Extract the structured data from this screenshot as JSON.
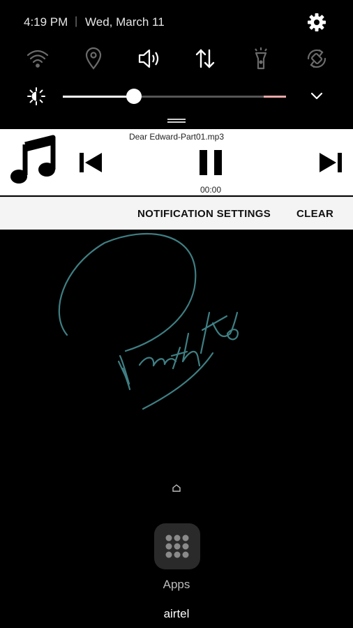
{
  "status": {
    "time": "4:19 PM",
    "separator": "|",
    "date": "Wed, March 11"
  },
  "quick_settings": [
    {
      "icon": "wifi-icon",
      "state": "off"
    },
    {
      "icon": "location-icon",
      "state": "off"
    },
    {
      "icon": "sound-icon",
      "state": "on"
    },
    {
      "icon": "mobile-data-icon",
      "state": "on"
    },
    {
      "icon": "flashlight-icon",
      "state": "off"
    },
    {
      "icon": "auto-rotate-icon",
      "state": "off"
    }
  ],
  "brightness": {
    "level": 0.32
  },
  "media": {
    "title": "Dear Edward-Part01.mp3",
    "elapsed": "00:00",
    "icons": [
      "music-note-icon",
      "previous-icon",
      "pause-icon",
      "next-icon"
    ]
  },
  "notification_actions": {
    "settings_label": "NOTIFICATION SETTINGS",
    "clear_label": "CLEAR"
  },
  "home": {
    "apps_label": "Apps",
    "carrier": "airtel"
  },
  "colors": {
    "card_bg": "#ffffff",
    "actions_bg": "#f4f4f4",
    "wallpaper_ink": "#3f7f83",
    "slider_end": "#e9a7a7"
  }
}
